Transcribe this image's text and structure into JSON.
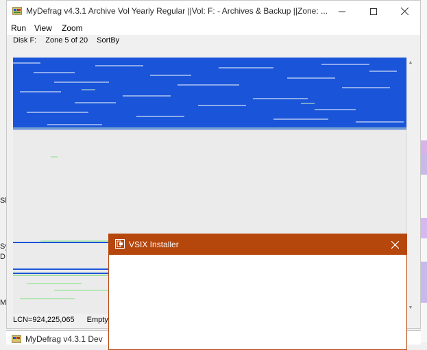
{
  "main_window": {
    "title": "MyDefrag v4.3.1    Archive Vol Yearly Regular ||Vol: F: - Archives & Backup ||Zone: ...",
    "menu": [
      "Run",
      "View",
      "Zoom"
    ],
    "status_top": {
      "disk": "Disk F:",
      "zone": "Zone 5 of 20",
      "sort": "SortBy"
    },
    "status_bottom": {
      "lcn": "LCN=924,225,065",
      "empty": "Empty sp"
    }
  },
  "second_window": {
    "title": "MyDefrag v4.3.1    Dev"
  },
  "dialog": {
    "title": "VSIX Installer"
  },
  "background_fragments": [
    "Sh",
    "Sy",
    "D",
    "M"
  ],
  "colors": {
    "map_blue": "#1a55d9",
    "map_empty": "#ebebeb",
    "dialog_title": "#b5460c"
  },
  "icons": [
    "mydefrag-app-icon",
    "minimize-icon",
    "maximize-icon",
    "close-icon",
    "vsix-icon",
    "dialog-close-icon",
    "scroll-up-icon",
    "scroll-down-icon"
  ]
}
